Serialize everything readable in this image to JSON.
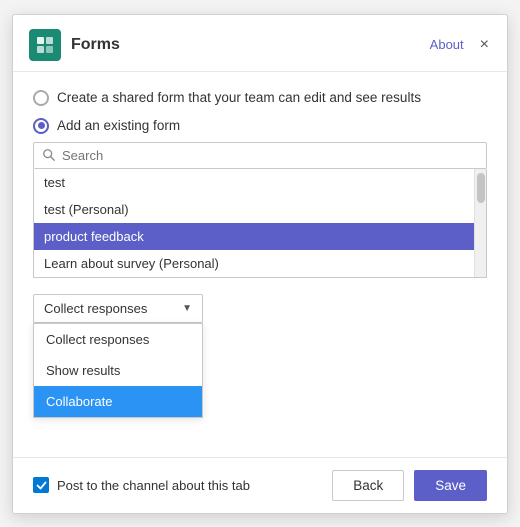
{
  "header": {
    "title": "Forms",
    "about_label": "About",
    "close_label": "×"
  },
  "options": {
    "create_shared_label": "Create a shared form that your team can edit and see results",
    "add_existing_label": "Add an existing form"
  },
  "search": {
    "placeholder": "Search"
  },
  "form_list": {
    "items": [
      {
        "label": "test",
        "active": false
      },
      {
        "label": "test (Personal)",
        "active": false
      },
      {
        "label": "product feedback",
        "active": true
      },
      {
        "label": "Learn about survey (Personal)",
        "active": false
      }
    ]
  },
  "dropdown": {
    "selected": "Collect responses",
    "items": [
      {
        "label": "Collect responses",
        "active": false
      },
      {
        "label": "Show results",
        "active": false
      },
      {
        "label": "Collaborate",
        "active": true
      }
    ]
  },
  "footer": {
    "checkbox_label": "Post to the channel about this tab",
    "back_label": "Back",
    "save_label": "Save"
  }
}
